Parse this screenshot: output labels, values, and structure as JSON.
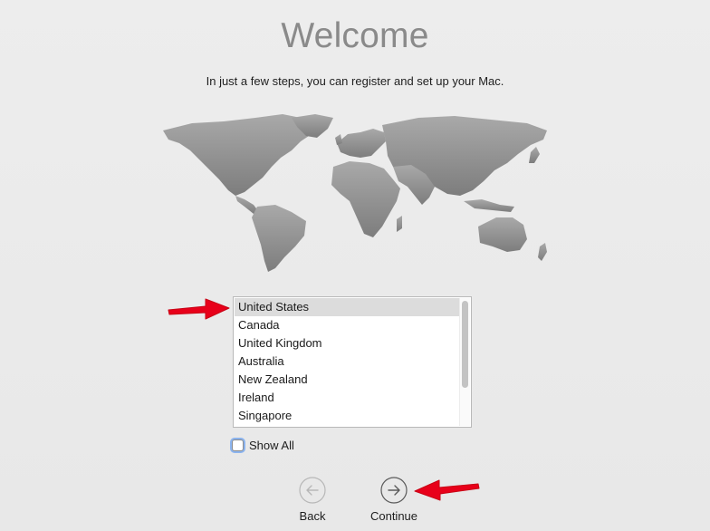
{
  "header": {
    "title": "Welcome",
    "subtitle": "In just a few steps, you can register and set up your Mac."
  },
  "country_list": {
    "items": [
      {
        "label": "United States",
        "selected": true
      },
      {
        "label": "Canada",
        "selected": false
      },
      {
        "label": "United Kingdom",
        "selected": false
      },
      {
        "label": "Australia",
        "selected": false
      },
      {
        "label": "New Zealand",
        "selected": false
      },
      {
        "label": "Ireland",
        "selected": false
      },
      {
        "label": "Singapore",
        "selected": false
      }
    ]
  },
  "show_all": {
    "label": "Show All",
    "checked": false
  },
  "navigation": {
    "back_label": "Back",
    "continue_label": "Continue"
  },
  "icons": {
    "back": "left-arrow-circle-icon",
    "continue": "right-arrow-circle-icon",
    "map": "world-map-icon"
  },
  "colors": {
    "annotation_arrow": "#e8001a",
    "selection": "#dcdcdc",
    "title": "#8a8a8a",
    "focus_ring": "#8cb4ee"
  }
}
